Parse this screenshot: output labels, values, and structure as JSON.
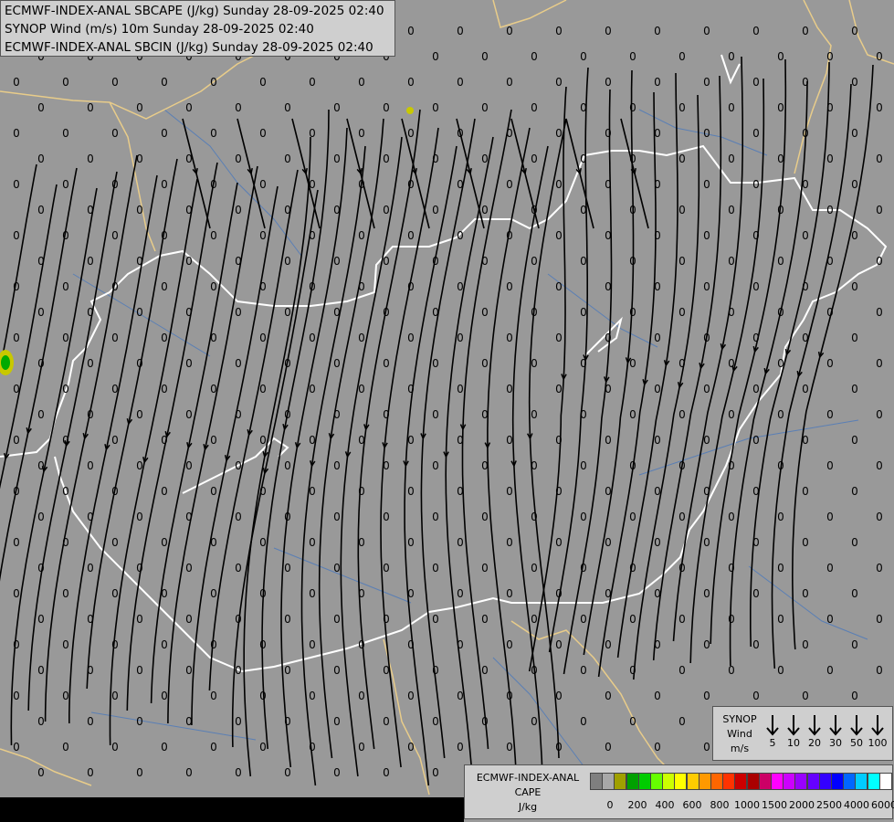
{
  "titles": {
    "line1": "ECMWF-INDEX-ANAL SBCAPE (J/kg) Sunday 28-09-2025 02:40",
    "line2": "SYNOP Wind (m/s) 10m Sunday 28-09-2025 02:40",
    "line3": "ECMWF-INDEX-ANAL SBCIN (J/kg) Sunday 28-09-2025 02:40"
  },
  "map": {
    "grid_value": "0",
    "colors": {
      "background": "#999999",
      "streamline": "#000000",
      "national_border": "#ffffff",
      "regional_border": "#e8cc8a",
      "river": "#5a7fb5",
      "cape_patch_outer": "#c8c800",
      "cape_patch_inner": "#00aa00"
    }
  },
  "wind_legend": {
    "title_1": "SYNOP",
    "title_2": "Wind",
    "unit": "m/s",
    "items": [
      "5",
      "10",
      "20",
      "30",
      "50",
      "100"
    ]
  },
  "cape_legend": {
    "title_1": "ECMWF-INDEX-ANAL",
    "title_2": "CAPE",
    "unit": "J/kg",
    "colors": [
      "#7f7f7f",
      "#a8a8a8",
      "#a0a000",
      "#00a000",
      "#00cc00",
      "#66ff00",
      "#ccff00",
      "#ffff00",
      "#ffcc00",
      "#ff9900",
      "#ff6600",
      "#ff3300",
      "#cc0000",
      "#aa0000",
      "#cc0066",
      "#ff00ff",
      "#cc00ff",
      "#9900ff",
      "#6600ff",
      "#3300ff",
      "#0000ff",
      "#0066ff",
      "#00ccff",
      "#00ffff",
      "#ffffff"
    ],
    "ticks": [
      "0",
      "200",
      "400",
      "600",
      "800",
      "1000",
      "1500",
      "2000",
      "2500",
      "4000",
      "6000"
    ]
  }
}
